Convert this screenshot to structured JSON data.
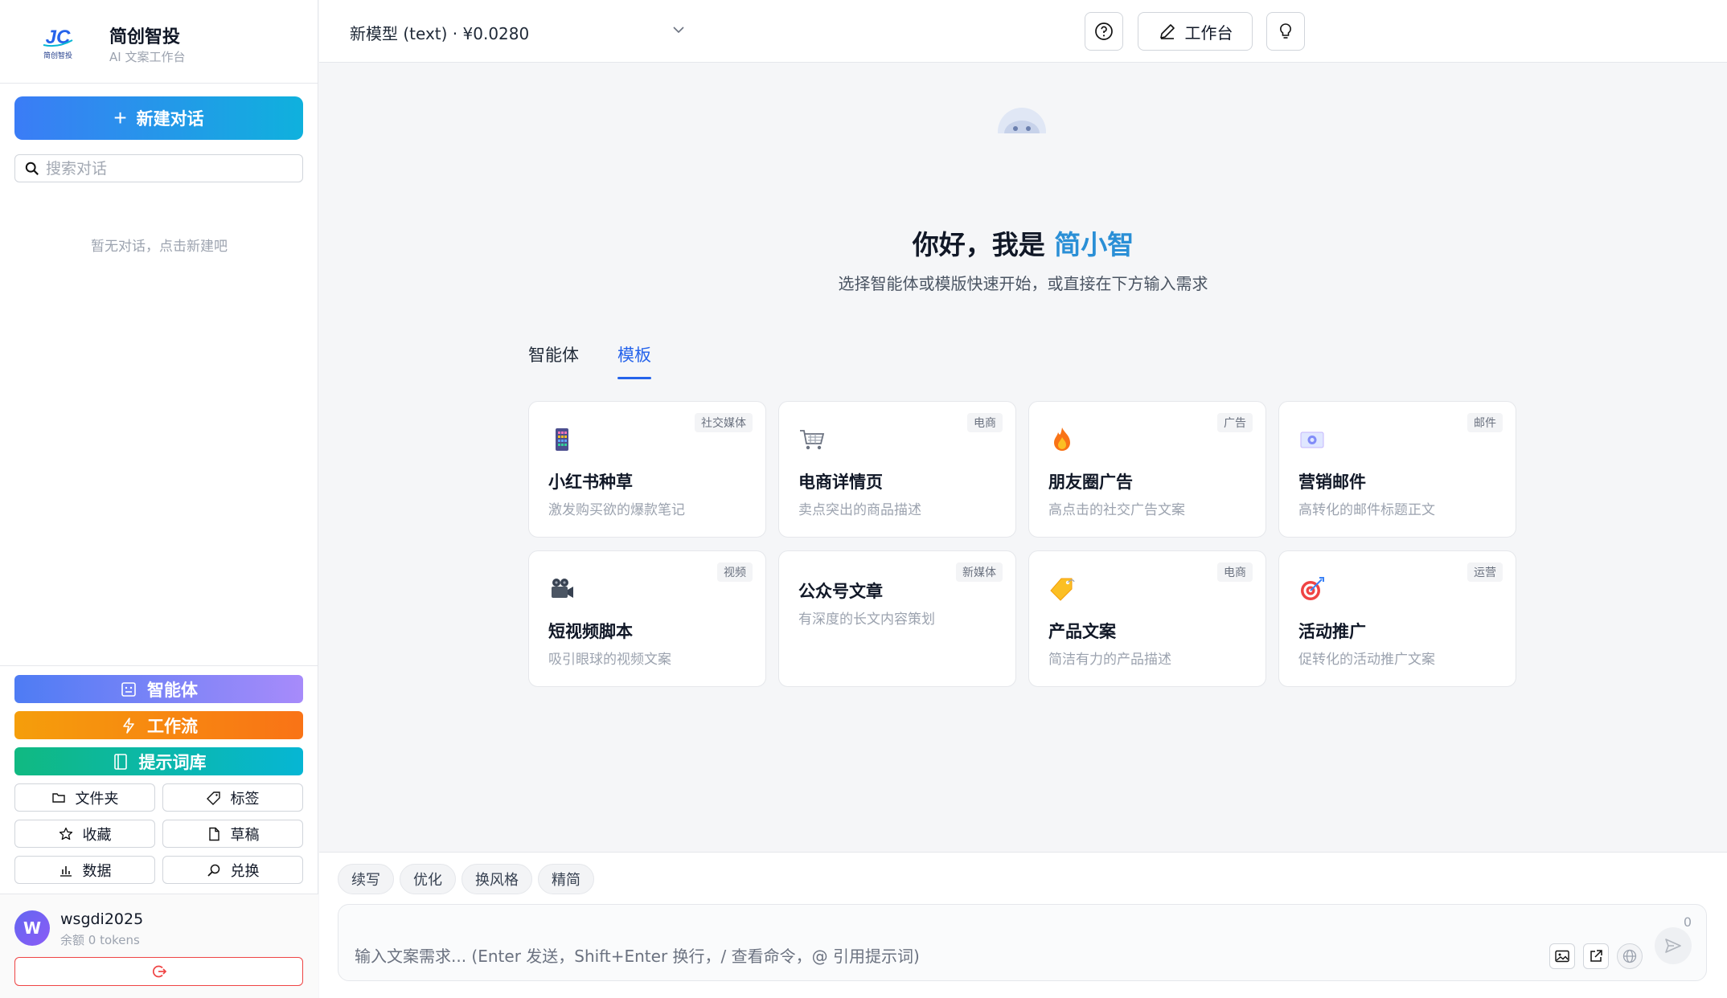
{
  "brand": {
    "name": "简创智投",
    "subtitle": "AI 文案工作台",
    "logo_text": "简创智投"
  },
  "sidebar": {
    "new_chat": "新建对话",
    "search_placeholder": "搜索对话",
    "empty_text": "暂无对话，点击新建吧",
    "agent_label": "智能体",
    "workflow_label": "工作流",
    "prompt_library_label": "提示词库",
    "small_buttons": [
      "文件夹",
      "标签",
      "收藏",
      "草稿",
      "数据",
      "兑换"
    ]
  },
  "user": {
    "avatar_letter": "W",
    "name": "wsgdi2025",
    "balance": "余额 0 tokens"
  },
  "topbar": {
    "model": "新模型 (text) · ¥0.0280",
    "workbench_label": "工作台"
  },
  "hero": {
    "greeting_prefix": "你好，我是 ",
    "greeting_name": "简小智",
    "subtitle": "选择智能体或模版快速开始，或直接在下方输入需求"
  },
  "tabs": [
    "智能体",
    "模板"
  ],
  "active_tab": "模板",
  "cards": [
    {
      "title": "小红书种草",
      "desc": "激发购买欲的爆款笔记",
      "tag": "社交媒体",
      "icon": "phone-icon"
    },
    {
      "title": "电商详情页",
      "desc": "卖点突出的商品描述",
      "tag": "电商",
      "icon": "shopping-cart-icon"
    },
    {
      "title": "朋友圈广告",
      "desc": "高点击的社交广告文案",
      "tag": "广告",
      "icon": "fire-icon"
    },
    {
      "title": "营销邮件",
      "desc": "高转化的邮件标题正文",
      "tag": "邮件",
      "icon": "envelope-icon"
    },
    {
      "title": "短视频脚本",
      "desc": "吸引眼球的视频文案",
      "tag": "视频",
      "icon": "movie-camera-icon"
    },
    {
      "title": "公众号文章",
      "desc": "有深度的长文内容策划",
      "tag": "新媒体",
      "icon": ""
    },
    {
      "title": "产品文案",
      "desc": "简洁有力的产品描述",
      "tag": "电商",
      "icon": "price-tag-icon"
    },
    {
      "title": "活动推广",
      "desc": "促转化的活动推广文案",
      "tag": "运营",
      "icon": "target-icon"
    }
  ],
  "chips": [
    "续写",
    "优化",
    "换风格",
    "精简"
  ],
  "input": {
    "placeholder": "输入文案需求... (Enter 发送，Shift+Enter 换行，/ 查看命令，@ 引用提示词)",
    "counter": "0"
  },
  "colors": {
    "accent": "#2563eb",
    "greeting_highlight": "#2a8fd6",
    "danger": "#ef4444"
  }
}
